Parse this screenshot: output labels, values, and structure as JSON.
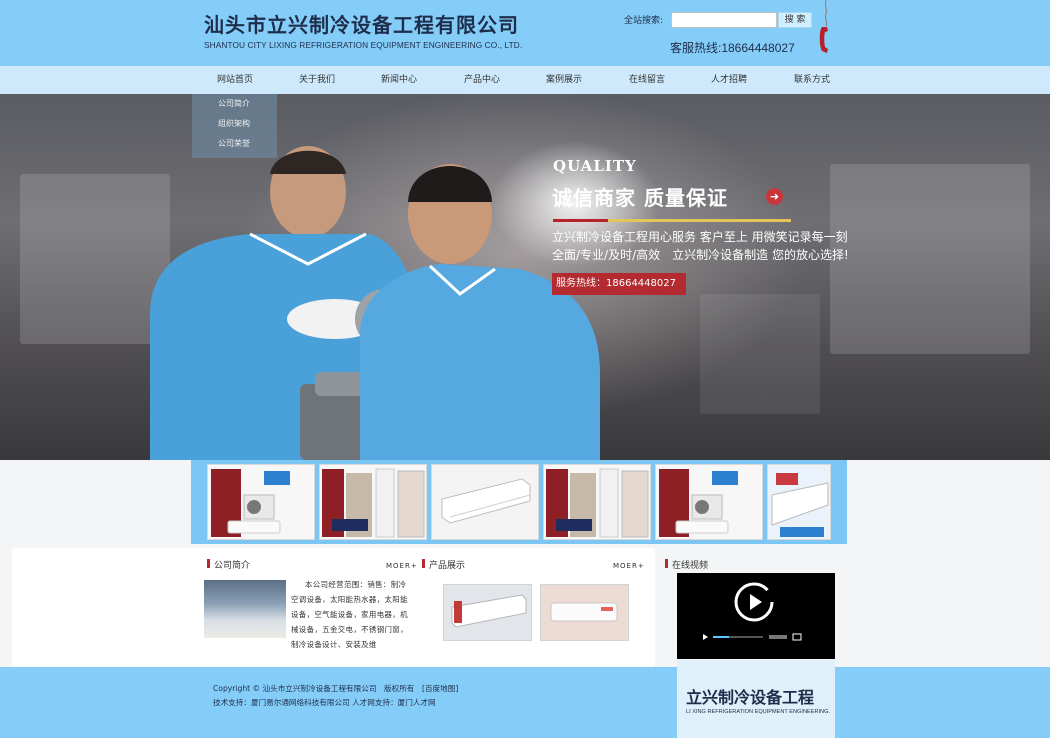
{
  "header": {
    "company_name_cn": "汕头市立兴制冷设备工程有限公司",
    "company_name_en": "SHANTOU CITY LIXING REFRIGERATION EQUIPMENT ENGINEERING CO., LTD.",
    "search_label": "全站搜索:",
    "search_value": "",
    "search_button": "搜 索",
    "hotline": "客服热线:18664448027"
  },
  "nav": {
    "items": [
      {
        "label": "网站首页"
      },
      {
        "label": "关于我们"
      },
      {
        "label": "新闻中心"
      },
      {
        "label": "产品中心"
      },
      {
        "label": "案例展示"
      },
      {
        "label": "在线留言"
      },
      {
        "label": "人才招聘"
      },
      {
        "label": "联系方式"
      }
    ],
    "submenu": [
      {
        "label": "公司简介"
      },
      {
        "label": "组织架构"
      },
      {
        "label": "公司荣誉"
      }
    ]
  },
  "banner": {
    "quality": "QUALITY",
    "slogan": "诚信商家 质量保证",
    "tagline1": "立兴制冷设备工程用心服务 客户至上 用微笑记录每一刻",
    "tagline2": "全面/专业/及时/高效　立兴制冷设备制造 您的放心选择!",
    "service_hotline": "服务热线：18664448027"
  },
  "product_strip": {
    "thumbs": [
      {
        "icon": "air-conditioner-set-icon"
      },
      {
        "icon": "standing-ac-icon"
      },
      {
        "icon": "wall-ac-icon"
      },
      {
        "icon": "standing-ac-icon"
      },
      {
        "icon": "air-conditioner-set-icon"
      },
      {
        "icon": "wall-ac-icon"
      }
    ]
  },
  "sections": {
    "about": {
      "title": "公司简介",
      "more": "MOER+",
      "text": "本公司经营范围：销售：制冷空调设备，太阳能热水器，太阳能设备，空气能设备，家用电器，机械设备，五金交电，不锈钢门窗，制冷设备设计、安装及维"
    },
    "products": {
      "title": "产品展示",
      "more": "MOER+"
    },
    "video": {
      "title": "在线视频"
    }
  },
  "footer": {
    "copyright": "Copyright © 汕头市立兴制冷设备工程有限公司　版权所有　[百度地图]",
    "support": "技术支持：厦门易尔通网络科技有限公司 人才网支持：厦门人才网",
    "logo_cn": "立兴制冷设备工程",
    "logo_en": "LI XING REFRIGERATION EQUIPMENT ENGINEERING."
  },
  "colors": {
    "header_bg": "#85cdf9",
    "nav_bg": "#cde9fb",
    "accent_red": "#b32a30",
    "gold": "#e5c45a",
    "text_dark": "#1e2d4a"
  }
}
